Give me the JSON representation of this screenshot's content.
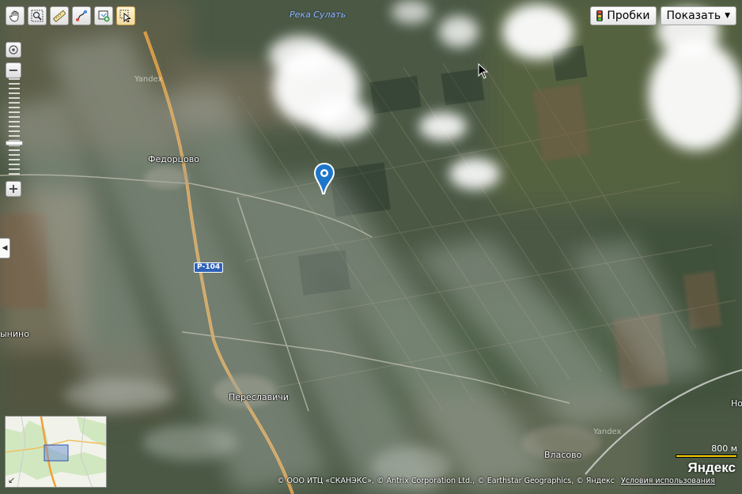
{
  "toolbar": {
    "tools": [
      "hand-icon",
      "magnifier-zoom-icon",
      "ruler-icon",
      "route-icon",
      "add-object-icon",
      "select-arrow-icon"
    ]
  },
  "header": {
    "traffic_label": "Пробки",
    "show_label": "Показать"
  },
  "map": {
    "labels": {
      "river": "Река Сулать",
      "fedortsovo": "Федорцово",
      "yanino": "ынино",
      "pereslavichi": "Переславичи",
      "vlasovo": "Власово",
      "no": "Но",
      "road": "Р-104"
    },
    "watermarks": [
      "Yandex",
      "Yandex"
    ]
  },
  "scale": {
    "label": "800 м"
  },
  "logo": "Яндекс",
  "copyright": {
    "text": "© ООО ИТЦ «СКАНЭКС», © Antrix Corporation Ltd., © Earthstar Geographics, © Яндекс",
    "terms": "Условия использования"
  },
  "colors": {
    "road": "#e0a24a",
    "marker": "#1d76c9",
    "scale_bar": "#ffd400"
  }
}
